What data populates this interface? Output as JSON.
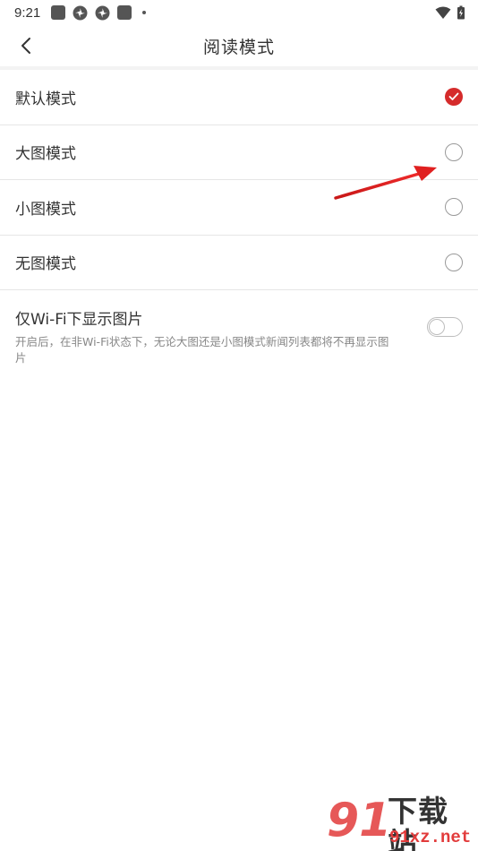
{
  "status_bar": {
    "time": "9:21"
  },
  "header": {
    "title": "阅读模式",
    "back_icon": "chevron-left-icon"
  },
  "options": [
    {
      "label": "默认模式",
      "checked": true
    },
    {
      "label": "大图模式",
      "checked": false
    },
    {
      "label": "小图模式",
      "checked": false
    },
    {
      "label": "无图模式",
      "checked": false
    }
  ],
  "wifi_setting": {
    "title": "仅Wi-Fi下显示图片",
    "description": "开启后，在非Wi-Fi状态下，无论大图还是小图模式新闻列表都将不再显示图片",
    "enabled": false
  },
  "colors": {
    "accent": "#d52b2b",
    "annotation_arrow": "#e02020",
    "text_primary": "#333333",
    "text_secondary": "#888888"
  },
  "watermark": {
    "logo_text": "91",
    "name": "下载站",
    "url": "91xz.net"
  }
}
